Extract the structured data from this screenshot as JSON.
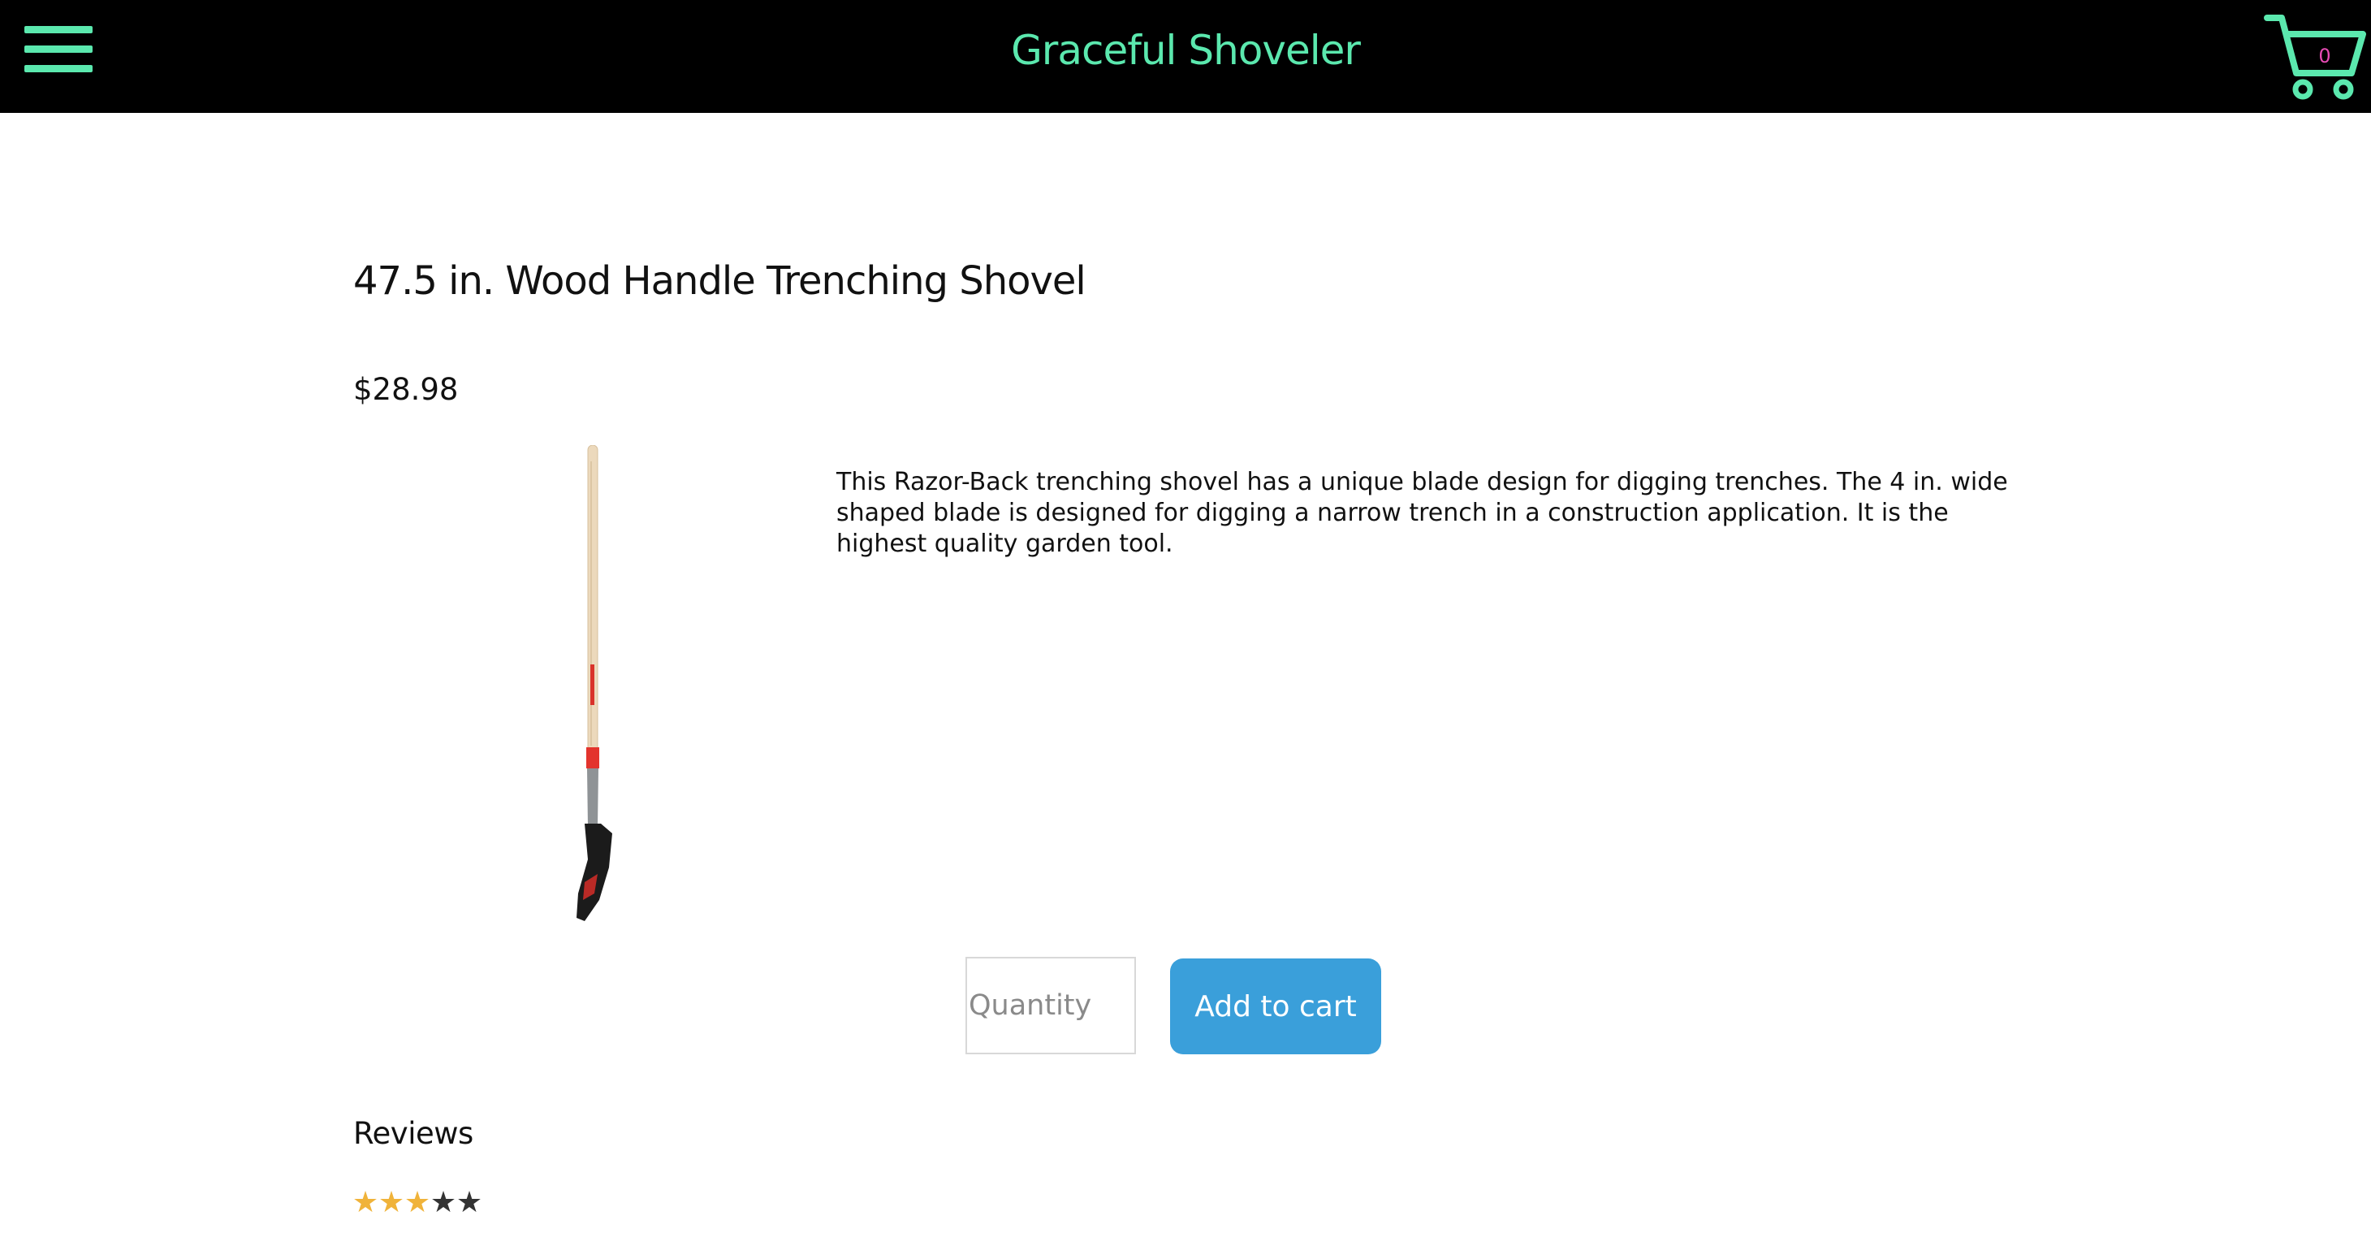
{
  "header": {
    "brand": "Graceful Shoveler",
    "menu_icon": "hamburger-menu-icon",
    "cart_icon": "shopping-cart-icon",
    "cart_count": "0"
  },
  "product": {
    "title": "47.5 in. Wood Handle Trenching Shovel",
    "price": "$28.98",
    "image_icon": "trenching-shovel-image",
    "description": "This Razor-Back trenching shovel has a unique blade design for digging trenches. The 4 in. wide shaped blade is designed for digging a narrow trench in a construction application. It is the highest quality garden tool."
  },
  "purchase": {
    "quantity_placeholder": "Quantity",
    "quantity_value": "",
    "add_to_cart_label": "Add to cart"
  },
  "reviews": {
    "heading": "Reviews",
    "rating": 3,
    "max_rating": 5
  },
  "colors": {
    "accent": "#5be8ae",
    "header_bg": "#000000",
    "button_bg": "#3a9fda",
    "star_filled": "#f0b33a",
    "star_empty": "#333333",
    "cart_count": "#e64bb4"
  }
}
